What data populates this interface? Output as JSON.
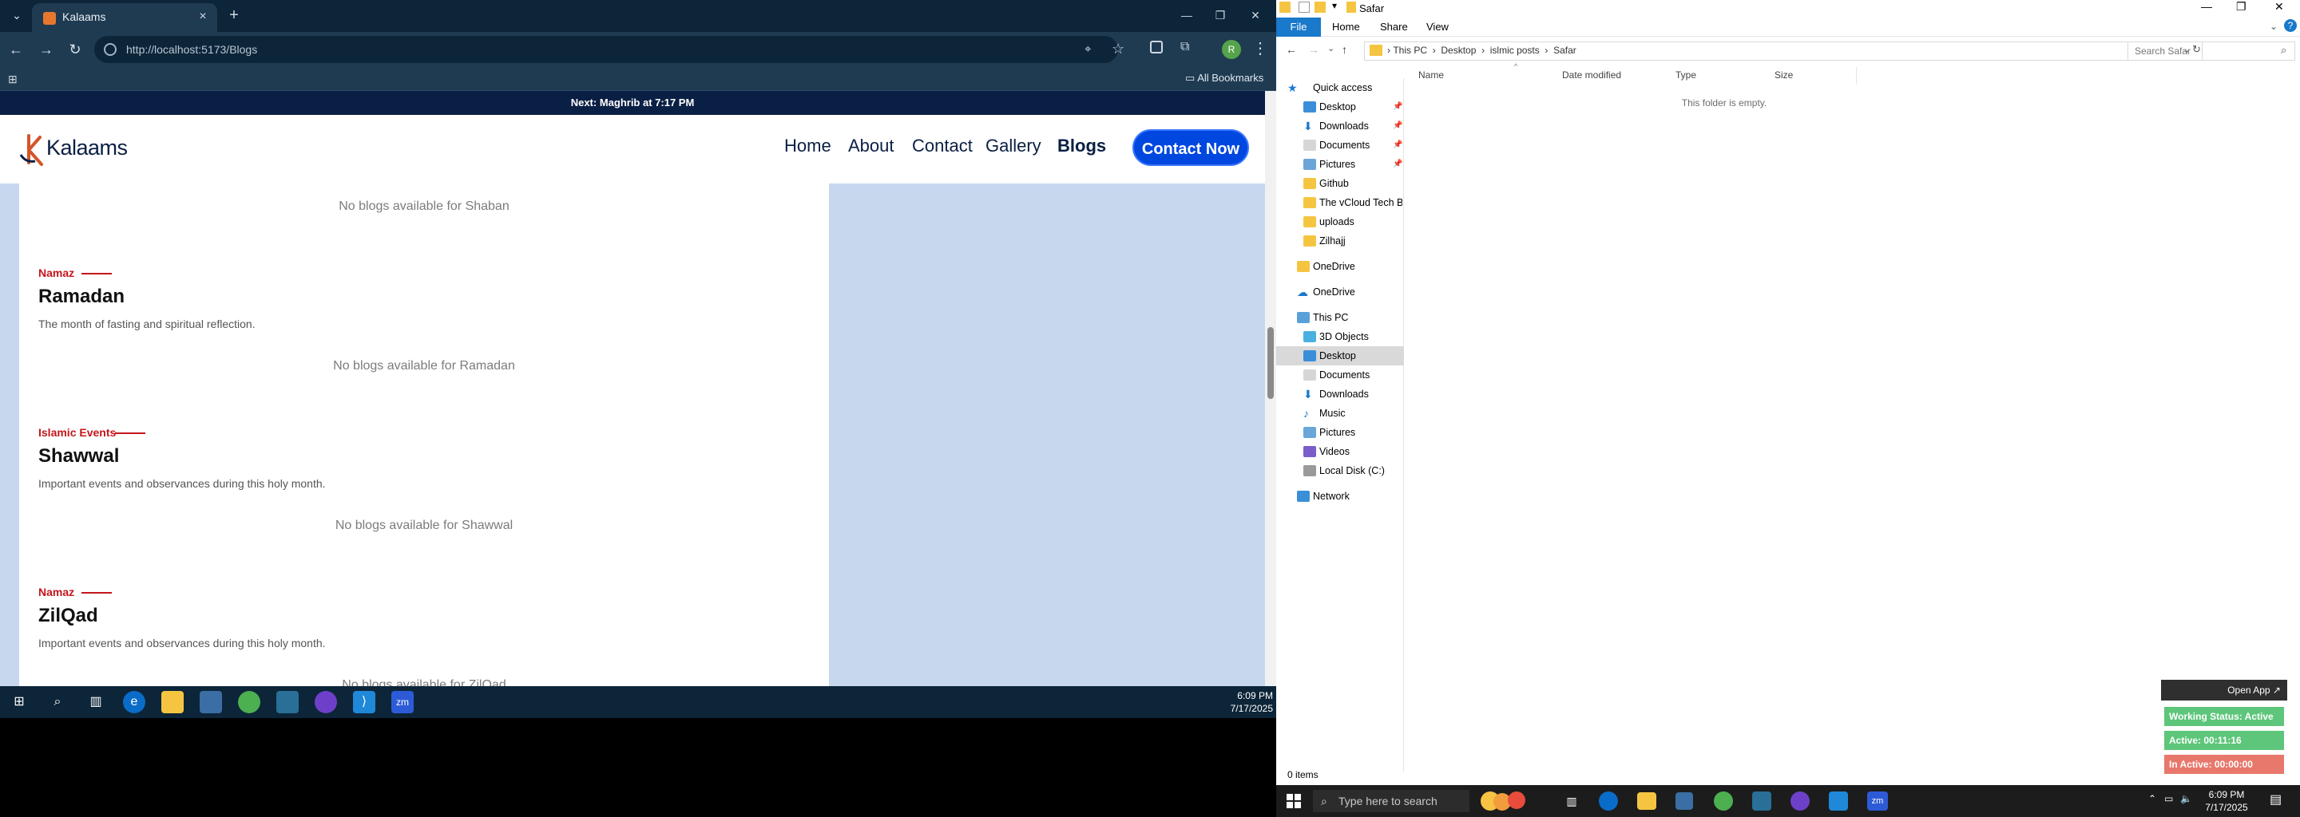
{
  "chrome": {
    "tab_title": "Kalaams",
    "url": "http://localhost:5173/Blogs",
    "all_bookmarks": "All Bookmarks",
    "profile_initial": "R"
  },
  "site": {
    "announcement": "Next: Maghrib at 7:17 PM",
    "logo": "Kalaams",
    "nav": [
      "Home",
      "About",
      "Contact",
      "Gallery",
      "Blogs"
    ],
    "cta": "Contact Now",
    "sections": [
      {
        "noblogs": "No blogs available for Shaban"
      },
      {
        "category": "Namaz",
        "title": "Ramadan",
        "desc": "The month of fasting and spiritual reflection.",
        "noblogs": "No blogs available for Ramadan"
      },
      {
        "category": "Islamic Events",
        "title": "Shawwal",
        "desc": "Important events and observances during this holy month.",
        "noblogs": "No blogs available for Shawwal"
      },
      {
        "category": "Namaz",
        "title": "ZilQad",
        "desc": "Important events and observances during this holy month.",
        "noblogs": "No blogs available for ZilQad"
      }
    ]
  },
  "explorer": {
    "title": "Safar",
    "ribbon_tabs": [
      "File",
      "Home",
      "Share",
      "View"
    ],
    "breadcrumb": [
      "This PC",
      "Desktop",
      "islmic posts",
      "Safar"
    ],
    "search_placeholder": "Search Safar",
    "columns": [
      "Name",
      "Date modified",
      "Type",
      "Size"
    ],
    "empty_message": "This folder is empty.",
    "status": "0 items",
    "nav": [
      {
        "label": "Quick access",
        "icon": "star-icon"
      },
      {
        "label": "Desktop",
        "icon": "desktop-icon",
        "pinned": true
      },
      {
        "label": "Downloads",
        "icon": "download-icon",
        "pinned": true
      },
      {
        "label": "Documents",
        "icon": "document-icon",
        "pinned": true
      },
      {
        "label": "Pictures",
        "icon": "pictures-icon",
        "pinned": true
      },
      {
        "label": "Github",
        "icon": "folder-icon"
      },
      {
        "label": "The vCloud Tech Bl",
        "icon": "folder-icon"
      },
      {
        "label": "uploads",
        "icon": "folder-icon"
      },
      {
        "label": "Zilhajj",
        "icon": "folder-icon"
      },
      {
        "label": "OneDrive",
        "icon": "folder-icon"
      },
      {
        "label": "OneDrive",
        "icon": "cloud-icon"
      },
      {
        "label": "This PC",
        "icon": "pc-icon"
      },
      {
        "label": "3D Objects",
        "icon": "cube-icon"
      },
      {
        "label": "Desktop",
        "icon": "desktop-icon"
      },
      {
        "label": "Documents",
        "icon": "document-icon"
      },
      {
        "label": "Downloads",
        "icon": "download-icon"
      },
      {
        "label": "Music",
        "icon": "music-icon"
      },
      {
        "label": "Pictures",
        "icon": "pictures-icon"
      },
      {
        "label": "Videos",
        "icon": "video-icon"
      },
      {
        "label": "Local Disk (C:)",
        "icon": "disk-icon"
      },
      {
        "label": "Network",
        "icon": "network-icon"
      }
    ]
  },
  "taskbar_left": {
    "time": "6:09 PM",
    "date": "7/17/2025"
  },
  "taskbar_right": {
    "search": "Type here to search",
    "time": "6:09 PM",
    "date": "7/17/2025"
  },
  "status_widget": {
    "open_app": "Open App ↗",
    "working": "Working Status: Active",
    "active": "Active: 00:11:16",
    "inactive": "In Active: 00:00:00"
  }
}
